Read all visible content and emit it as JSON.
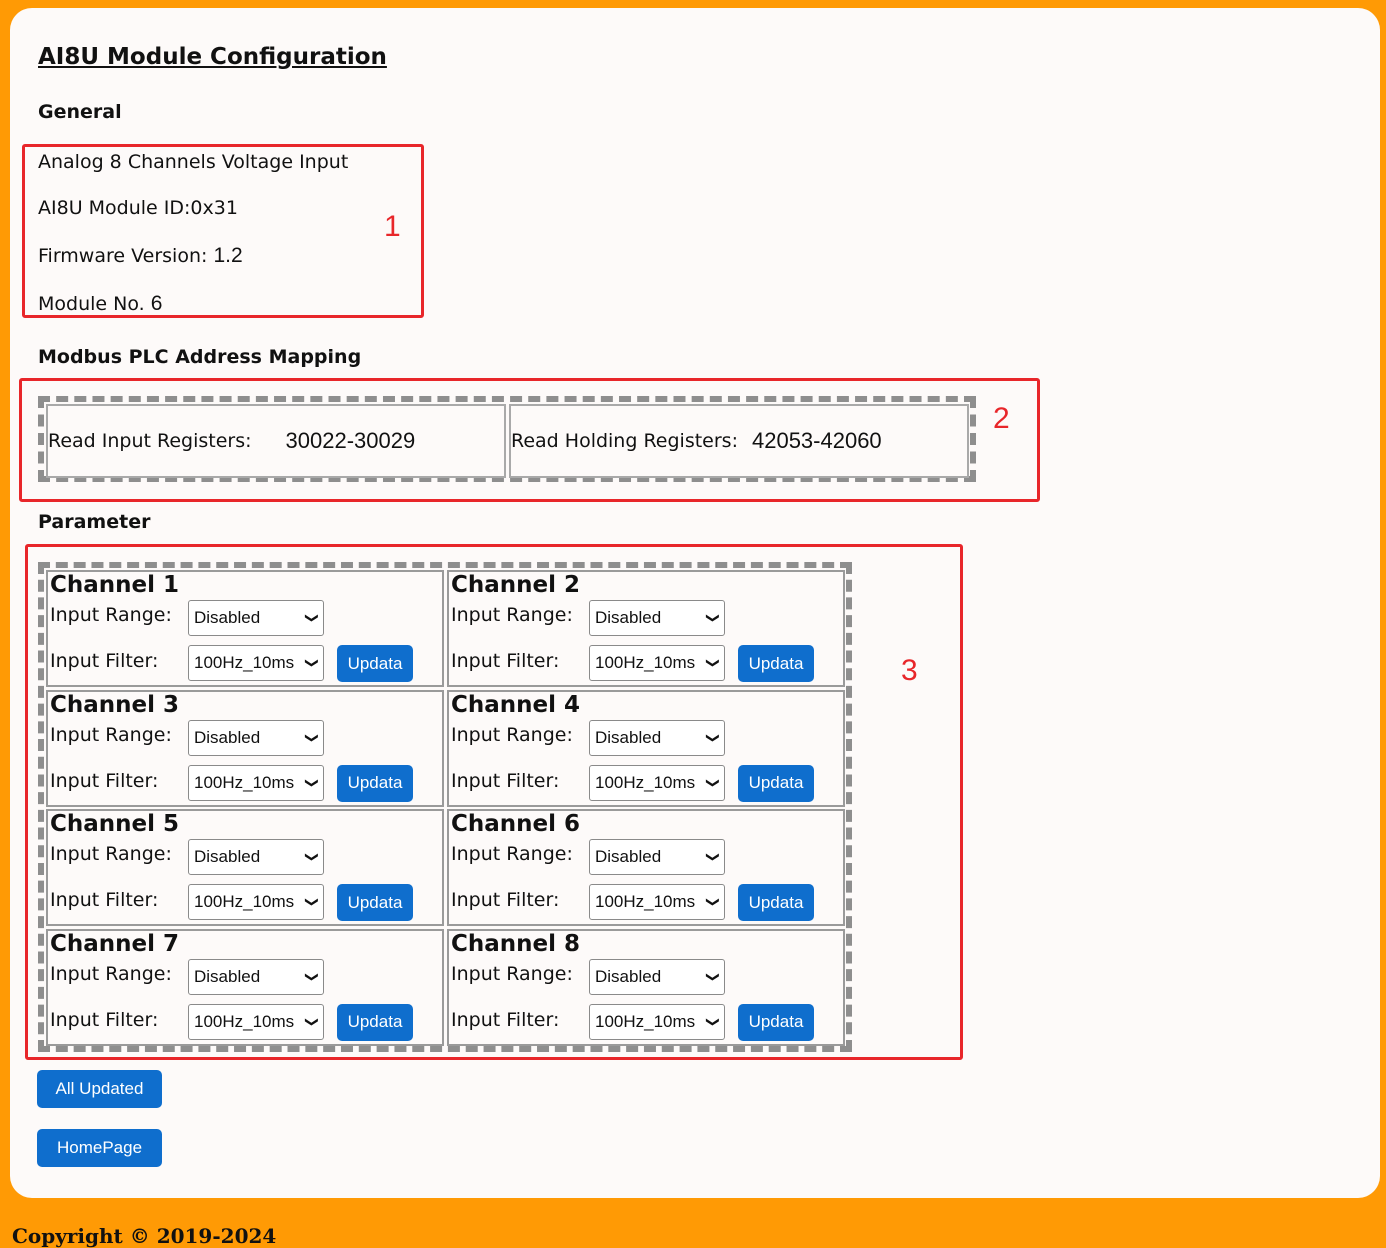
{
  "page_title": "AI8U Module Configuration",
  "general": {
    "heading": "General",
    "description": "Analog 8 Channels Voltage Input",
    "module_id_label": "AI8U Module ID:",
    "module_id": "0x31",
    "firmware_label": "Firmware Version: ",
    "firmware": "1.2",
    "module_no_label": "Module No. ",
    "module_no": "6"
  },
  "modbus": {
    "heading": "Modbus PLC Address Mapping",
    "input_label": "Read Input Registers:",
    "input_value": "30022-30029",
    "holding_label": "Read Holding Registers:",
    "holding_value": "42053-42060"
  },
  "parameter": {
    "heading": "Parameter",
    "range_label": "Input Range:",
    "filter_label": "Input Filter:",
    "update_label": "Updata",
    "channels": [
      {
        "name": "Channel 1",
        "range": "Disabled",
        "filter": "100Hz_10ms"
      },
      {
        "name": "Channel 2",
        "range": "Disabled",
        "filter": "100Hz_10ms"
      },
      {
        "name": "Channel 3",
        "range": "Disabled",
        "filter": "100Hz_10ms"
      },
      {
        "name": "Channel 4",
        "range": "Disabled",
        "filter": "100Hz_10ms"
      },
      {
        "name": "Channel 5",
        "range": "Disabled",
        "filter": "100Hz_10ms"
      },
      {
        "name": "Channel 6",
        "range": "Disabled",
        "filter": "100Hz_10ms"
      },
      {
        "name": "Channel 7",
        "range": "Disabled",
        "filter": "100Hz_10ms"
      },
      {
        "name": "Channel 8",
        "range": "Disabled",
        "filter": "100Hz_10ms"
      }
    ]
  },
  "annotations": [
    "1",
    "2",
    "3"
  ],
  "buttons": {
    "all_updated": "All Updated",
    "homepage": "HomePage"
  },
  "footer": "Copyright © 2019-2024",
  "colors": {
    "background": "#ff9a05",
    "panel": "#fdfaf9",
    "button": "#0f6ecd",
    "annotation": "#e8262a"
  }
}
